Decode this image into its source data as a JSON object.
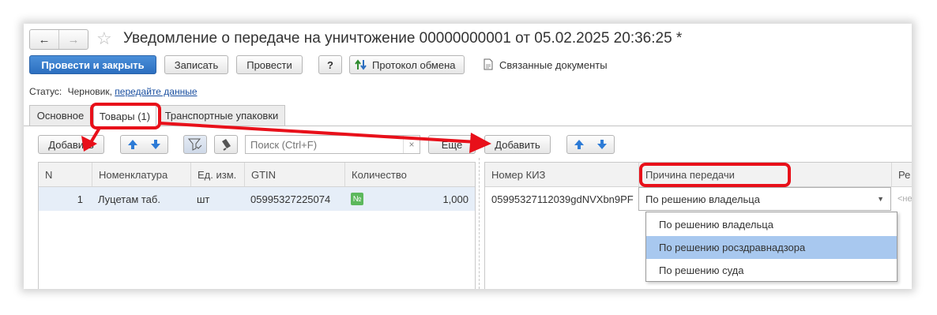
{
  "nav": {
    "back_icon": "arrow-left-icon",
    "forward_icon": "arrow-right-icon",
    "star_icon": "star-icon"
  },
  "title": "Уведомление о передаче на уничтожение 00000000001 от 05.02.2025 20:36:25 *",
  "toolbar": {
    "post_close": "Провести и закрыть",
    "save": "Записать",
    "post": "Провести",
    "help": "?",
    "exchange_log": "Протокол обмена",
    "related_docs": "Связанные документы"
  },
  "status": {
    "label": "Статус:",
    "value": "Черновик,",
    "link": "передайте данные"
  },
  "tabs": [
    {
      "label": "Основное"
    },
    {
      "label": "Товары (1)"
    },
    {
      "label": "Транспортные упаковки"
    }
  ],
  "left_panel": {
    "add": "Добавить",
    "search_placeholder": "Поиск (Ctrl+F)",
    "more": "Еще",
    "columns": [
      "N",
      "Номенклатура",
      "Ед. изм.",
      "GTIN",
      "Количество"
    ],
    "rows": [
      {
        "n": "1",
        "item": "Луцетам таб.",
        "unit": "шт",
        "gtin": "05995327225074",
        "badge": "№",
        "qty": "1,000"
      }
    ]
  },
  "right_panel": {
    "add": "Добавить",
    "columns": [
      "Номер КИЗ",
      "Причина передачи",
      "Ре"
    ],
    "rows": [
      {
        "kiz": "05995327112039gdNVXbn9PF",
        "reason": "По решению владельца",
        "extra": "<не"
      }
    ],
    "dropdown_options": [
      "По решению владельца",
      "По решению росздравнадзора",
      "По решению суда"
    ],
    "dropdown_selected": "По решению росздравнадзора"
  },
  "colors": {
    "primary": "#2c6fc0",
    "highlight": "#e8101a",
    "row_selected": "#e6eef8",
    "option_selected": "#a8c8ef"
  }
}
